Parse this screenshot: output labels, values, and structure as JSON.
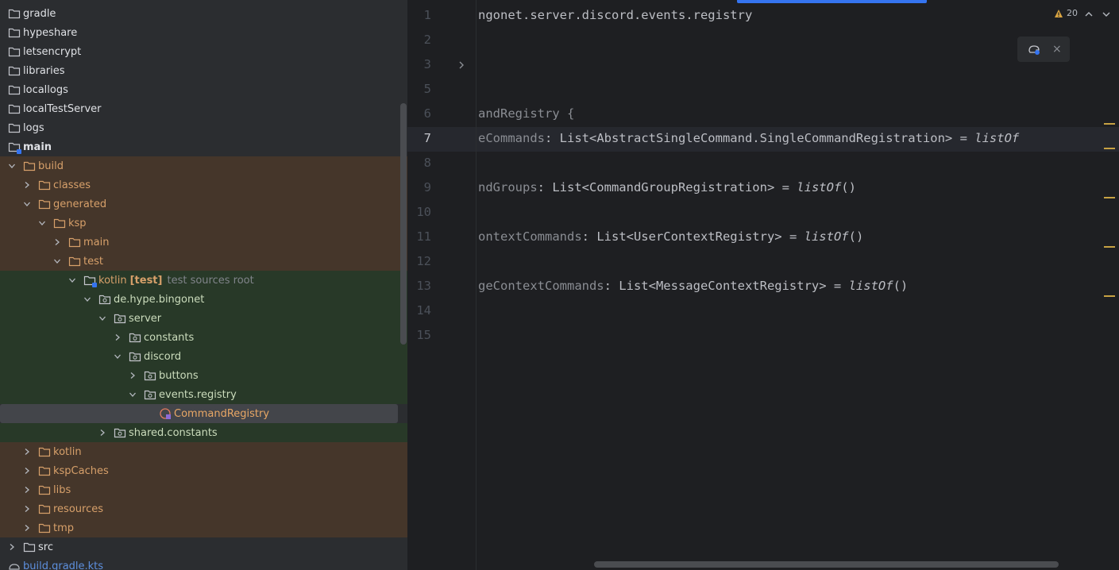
{
  "tree": {
    "rows": [
      {
        "label": "gradle"
      },
      {
        "label": "hypeshare"
      },
      {
        "label": "letsencrypt"
      },
      {
        "label": "libraries"
      },
      {
        "label": "locallogs"
      },
      {
        "label": "localTestServer"
      },
      {
        "label": "logs"
      },
      {
        "label": "main"
      },
      {
        "label": "build"
      },
      {
        "label": "classes"
      },
      {
        "label": "generated"
      },
      {
        "label": "ksp"
      },
      {
        "label": "main"
      },
      {
        "label": "test"
      },
      {
        "label": "kotlin",
        "tag": "[test]",
        "hint": "test sources root"
      },
      {
        "label": "de.hype.bingonet"
      },
      {
        "label": "server"
      },
      {
        "label": "constants"
      },
      {
        "label": "discord"
      },
      {
        "label": "buttons"
      },
      {
        "label": "events.registry"
      },
      {
        "label": "CommandRegistry"
      },
      {
        "label": "shared.constants"
      },
      {
        "label": "kotlin"
      },
      {
        "label": "kspCaches"
      },
      {
        "label": "libs"
      },
      {
        "label": "resources"
      },
      {
        "label": "tmp"
      },
      {
        "label": "src"
      },
      {
        "label": "build.gradle.kts"
      }
    ]
  },
  "editor": {
    "warnings_count": "20",
    "line_numbers": [
      "1",
      "2",
      "3",
      "5",
      "6",
      "7",
      "8",
      "9",
      "10",
      "11",
      "12",
      "13",
      "14",
      "15"
    ],
    "lines": {
      "l1": "ngonet.server.discord.events.registry",
      "l6": "andRegistry {",
      "l7a": "eCommands",
      "l7b": ": List<AbstractSingleCommand.SingleCommandRegistration> = ",
      "l7c": "listOf",
      "l9a": "ndGroups",
      "l9b": ": List<CommandGroupRegistration> = ",
      "l9c": "listOf",
      "l9d": "()",
      "l11a": "ontextCommands",
      "l11b": ": List<UserContextRegistry> = ",
      "l11c": "listOf",
      "l11d": "()",
      "l13a": "geContextCommands",
      "l13b": ": List<MessageContextRegistry> = ",
      "l13c": "listOf",
      "l13d": "()"
    },
    "ai_popup_close": "×"
  }
}
